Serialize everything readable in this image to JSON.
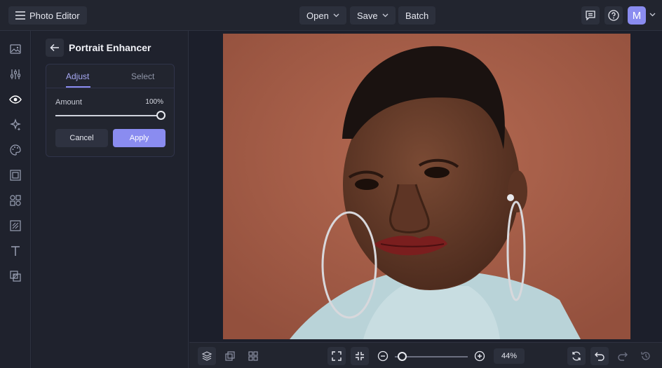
{
  "app": {
    "title": "Photo Editor"
  },
  "toolbar": {
    "open_label": "Open",
    "save_label": "Save",
    "batch_label": "Batch"
  },
  "user": {
    "avatar_letter": "M"
  },
  "rail": {
    "items": [
      "image-icon",
      "sliders-icon",
      "eye-icon",
      "sparkle-icon",
      "palette-icon",
      "frame-icon",
      "shapes-icon",
      "texture-icon",
      "text-icon",
      "overlay-icon"
    ]
  },
  "panel": {
    "title": "Portrait Enhancer",
    "tabs": [
      {
        "label": "Adjust",
        "active": true
      },
      {
        "label": "Select",
        "active": false
      }
    ],
    "amount_label": "Amount",
    "amount_value": "100%",
    "amount_fraction": 1.0,
    "cancel_label": "Cancel",
    "apply_label": "Apply"
  },
  "bottom": {
    "zoom_value": "44%",
    "zoom_fraction": 0.1
  },
  "colors": {
    "accent": "#8a8cf0",
    "background": "#1c1f2b",
    "panel": "#1f222d"
  }
}
